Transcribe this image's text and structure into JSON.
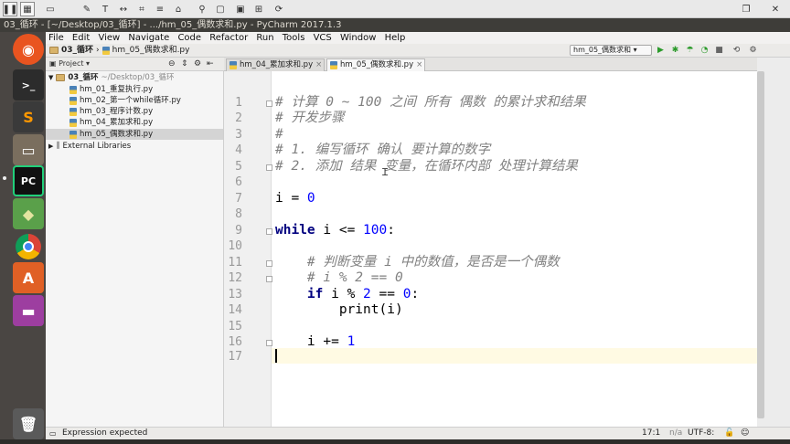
{
  "toolbar": {
    "icons": [
      "pause-icon",
      "grid-icon",
      "swap-icon",
      "crop-icon",
      "wrench-icon",
      "text-icon",
      "stack-icon",
      "lock-icon",
      "pin-icon",
      "usb-icon",
      "doc-icon",
      "save-icon",
      "grid2-icon",
      "refresh-icon"
    ],
    "right_icons": [
      "window-icon",
      "close-icon"
    ]
  },
  "window": {
    "title": "03_循环 - [~/Desktop/03_循环] - .../hm_05_偶数求和.py - PyCharm 2017.1.3"
  },
  "launcher": {
    "items": [
      {
        "name": "ubuntu-dash",
        "label": "",
        "color": "#e95420"
      },
      {
        "name": "terminal",
        "label": ">_",
        "color": "#2c2c2c"
      },
      {
        "name": "sublime",
        "label": "S",
        "color": "#3a3a3a"
      },
      {
        "name": "files",
        "label": "",
        "color": "#7a6e5e"
      },
      {
        "name": "pycharm",
        "label": "PC",
        "color": "#21a366"
      },
      {
        "name": "stack",
        "label": "",
        "color": "#5aa04a"
      },
      {
        "name": "chrome",
        "label": "",
        "color": "#4285f4"
      },
      {
        "name": "software",
        "label": "A",
        "color": "#e06025"
      },
      {
        "name": "app",
        "label": "",
        "color": "#9d3ea0"
      },
      {
        "name": "trash",
        "label": "",
        "color": "#5a5a5a"
      }
    ]
  },
  "menu": [
    "File",
    "Edit",
    "View",
    "Navigate",
    "Code",
    "Refactor",
    "Run",
    "Tools",
    "VCS",
    "Window",
    "Help"
  ],
  "nav": {
    "crumbs": [
      "03_循环",
      "hm_05_偶数求和.py"
    ],
    "run_config": "hm_05_偶数求和"
  },
  "project": {
    "header": "Project",
    "root": "03_循环",
    "root_path": "~/Desktop/03_循环",
    "files": [
      "hm_01_重复执行.py",
      "hm_02_第一个while循环.py",
      "hm_03_程序计数.py",
      "hm_04_累加求和.py",
      "hm_05_偶数求和.py"
    ],
    "external": "External Libraries"
  },
  "tabs": [
    "hm_04_累加求和.py",
    "hm_05_偶数求和.py"
  ],
  "editor": {
    "line_numbers": [
      "1",
      "2",
      "3",
      "4",
      "5",
      "6",
      "7",
      "8",
      "9",
      "10",
      "11",
      "12",
      "13",
      "14",
      "15",
      "16",
      "17"
    ],
    "code": {
      "l1": "# 计算 0 ~ 100 之间 所有 偶数 的累计求和结果",
      "l2": "# 开发步骤",
      "l3": "#",
      "l4": "# 1. 编写循环 确认 要计算的数字",
      "l5": "# 2. 添加 结果 变量，在循环内部 处理计算结果",
      "l7_a": "i = ",
      "l7_b": "0",
      "l9_kw": "while",
      "l9_a": " i <= ",
      "l9_b": "100",
      "l9_c": ":",
      "l11": "    # 判断变量 i 中的数值，是否是一个偶数",
      "l12": "    # i % 2 == 0",
      "l13_pre": "    ",
      "l13_kw": "if",
      "l13_a": " i % ",
      "l13_b": "2",
      "l13_c": " == ",
      "l13_d": "0",
      "l13_e": ":",
      "l14": "        print(i)",
      "l16_a": "    i += ",
      "l16_b": "1"
    }
  },
  "status": {
    "message": "Expression expected",
    "position": "17:1",
    "na": "n/a",
    "encoding": "UTF-8:"
  }
}
